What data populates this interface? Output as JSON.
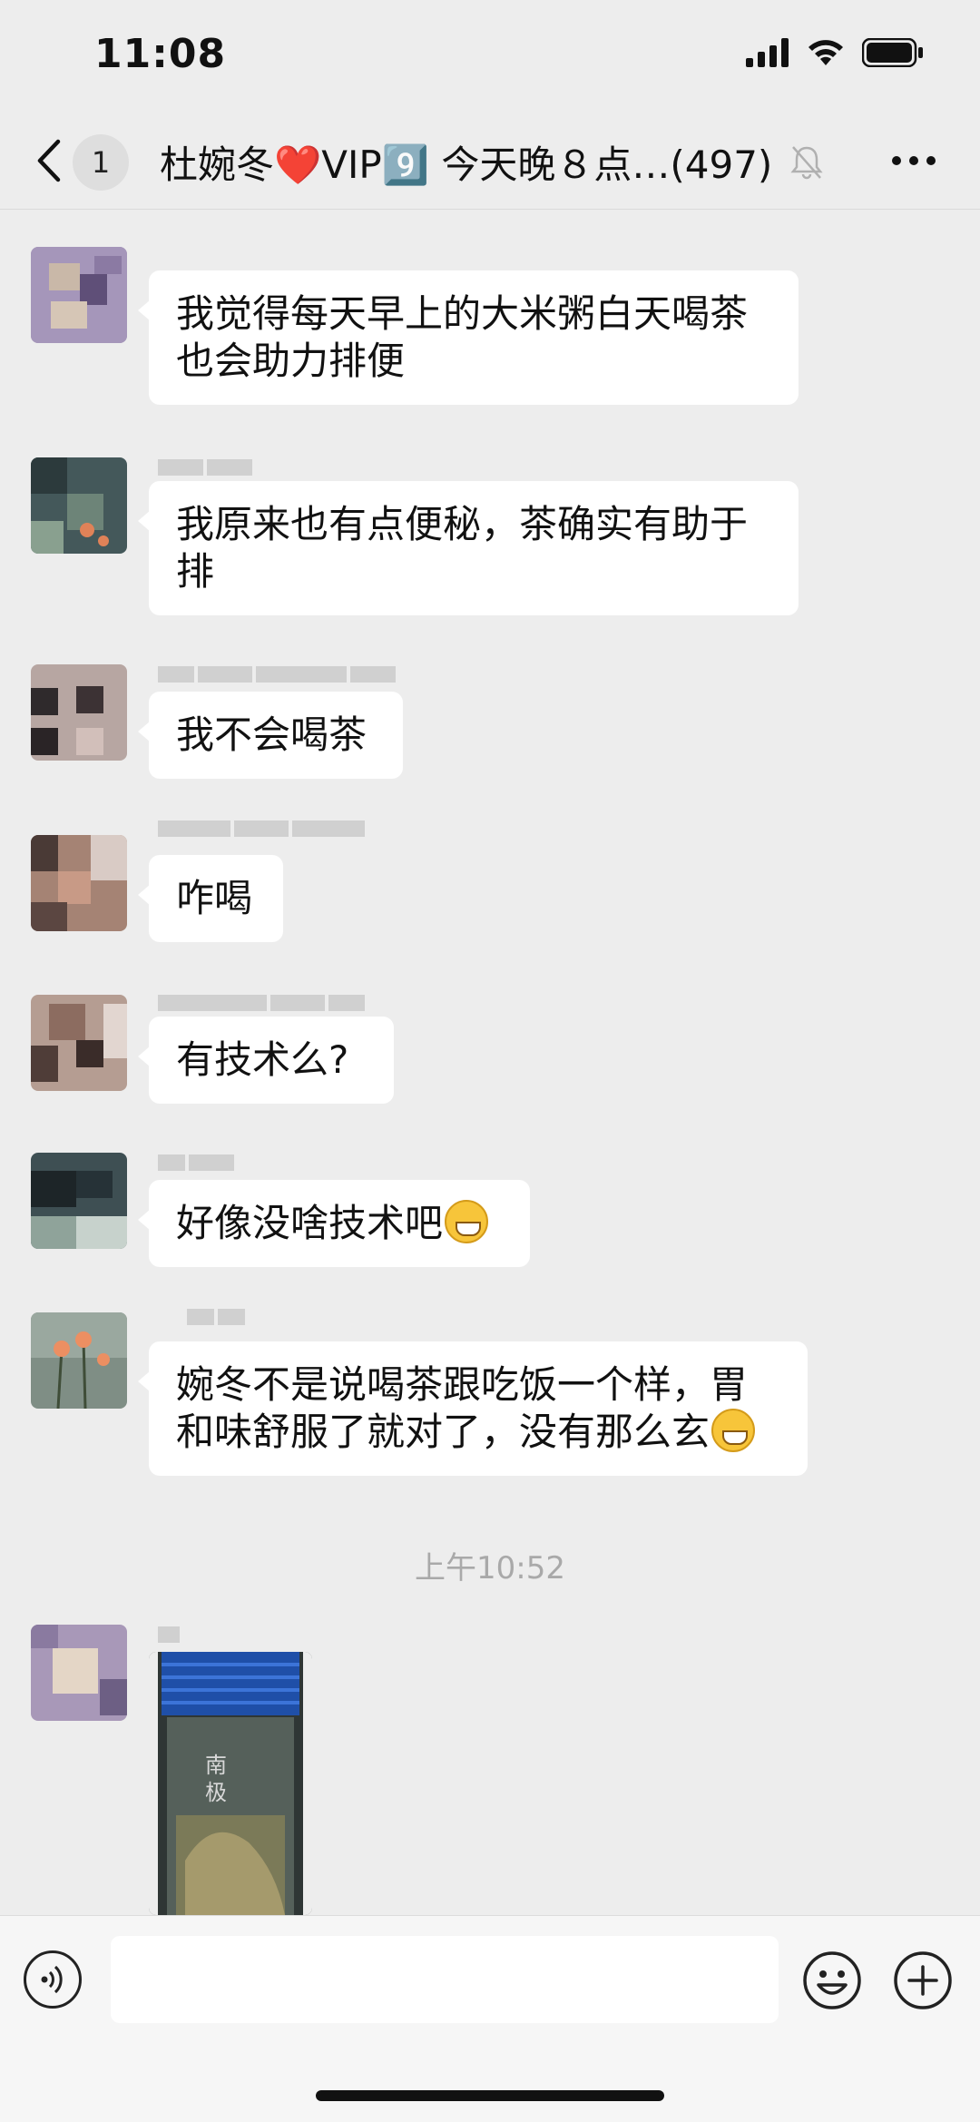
{
  "status_bar": {
    "time": "11:08"
  },
  "header": {
    "back_count": "1",
    "title": "杜婉冬❤️VIP9️⃣ 今天晚８点…(497)",
    "muted": true
  },
  "messages": [
    {
      "text": "我觉得每天早上的大米粥白天喝茶也会助力排便"
    },
    {
      "text": "我原来也有点便秘，茶确实有助于排"
    },
    {
      "text": "我不会喝茶"
    },
    {
      "text": "咋喝"
    },
    {
      "text": "有技术么?"
    },
    {
      "text": "好像没啥技术吧",
      "emoji": "grinning-face"
    },
    {
      "text": "婉冬不是说喝茶跟吃饭一个样，胃和味舒服了就对了，没有那么玄",
      "emoji": "grinning-face"
    }
  ],
  "time_divider": "上午10:52",
  "photo_text": "南 极",
  "icons": {
    "back": "chevron-left-icon",
    "mute": "bell-slash-icon",
    "more": "more-icon",
    "voice": "voice-icon",
    "emoji": "smiley-icon",
    "plus": "plus-icon"
  },
  "colors": {
    "background": "#ededed",
    "bubble": "#ffffff",
    "input_bar": "#f6f6f6"
  }
}
